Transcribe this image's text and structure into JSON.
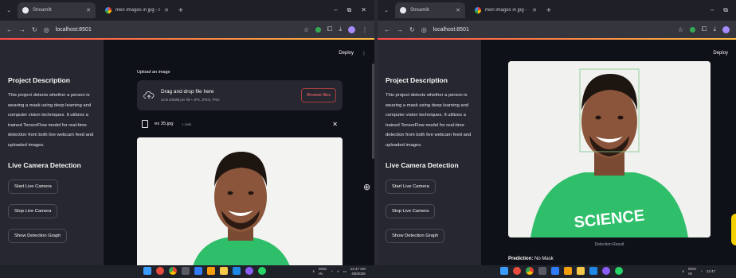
{
  "left_window": {
    "tabs": [
      {
        "label": "Streamlit",
        "icon": "streamlit-favicon-icon",
        "active": true
      },
      {
        "label": "men images in jpg - Google S",
        "icon": "google-favicon-icon",
        "active": false
      }
    ],
    "url": "localhost:8501",
    "app": {
      "deploy_label": "Deploy",
      "sidebar": {
        "heading": "Project Description",
        "description": "This project detects whether a person is wearing a mask using deep learning and computer vision techniques. It utilizes a trained TensorFlow model for real-time detection from both live webcam feed and uploaded images.",
        "section_heading": "Live Camera Detection",
        "buttons": [
          "Start Live Camera",
          "Stop Live Camera",
          "Show Detection Graph"
        ]
      },
      "uploader": {
        "label": "Upload an image",
        "drop_text": "Drag and drop file here",
        "limit_text": "Limit 200MB per file • JPG, JPEG, PNG",
        "browse_label": "Browse files",
        "file_name": "ex 35.jpg",
        "file_size": "1.2MB"
      }
    }
  },
  "right_window": {
    "tabs": [
      {
        "label": "Streamlit",
        "icon": "streamlit-favicon-icon",
        "active": true
      },
      {
        "label": "men images in jpg - Google S",
        "icon": "google-favicon-icon",
        "active": false
      }
    ],
    "url": "localhost:8501",
    "app": {
      "deploy_label": "Deploy",
      "sidebar": {
        "heading": "Project Description",
        "description": "This project detects whether a person is wearing a mask using deep learning and computer vision techniques. It utilizes a trained TensorFlow model for real-time detection from both live webcam feed and uploaded images.",
        "section_heading": "Live Camera Detection",
        "buttons": [
          "Start Live Camera",
          "Stop Live Camera",
          "Show Detection Graph"
        ]
      },
      "image_caption": "Detection Result",
      "shirt_text": "SCIENCE",
      "prediction_label": "Prediction:",
      "prediction_value": "No Mask"
    }
  },
  "taskbar": {
    "left_clock": {
      "lang": "ENG",
      "lang_sub": "IN",
      "time": "12:47 AM",
      "date": "4/8/2025"
    },
    "right_clock": {
      "lang": "ENG",
      "lang_sub": "IN",
      "time": "12:47"
    }
  },
  "colors": {
    "app_bg": "#0e1117",
    "sidebar_bg": "#262730",
    "accent_red": "#ff4b4b",
    "shirt_green": "#2fbf6a"
  }
}
